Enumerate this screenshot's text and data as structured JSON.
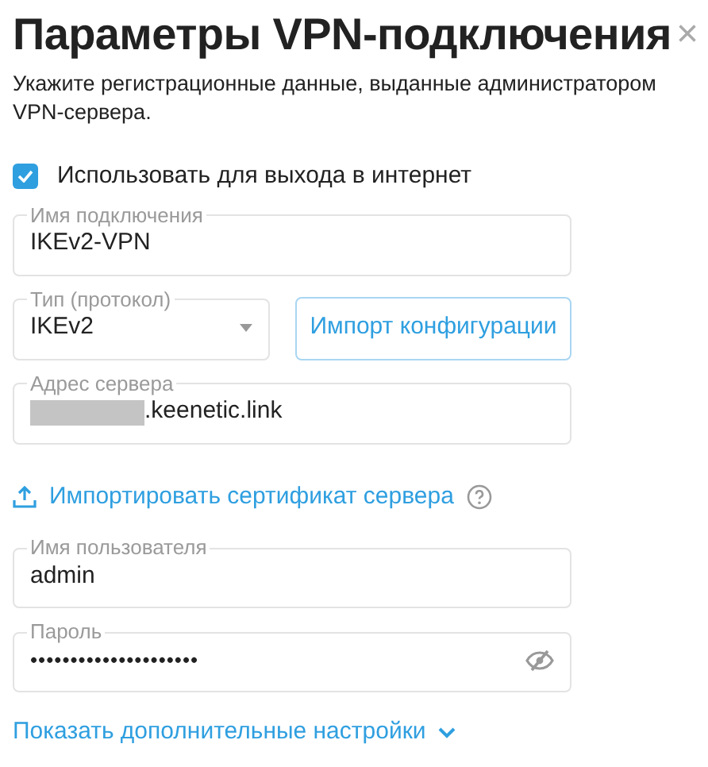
{
  "dialog": {
    "title": "Параметры VPN-подключения",
    "close": "×",
    "description": "Укажите регистрационные данные, выданные администратором VPN-сервера."
  },
  "internet_checkbox": {
    "label": "Использовать для выхода в интернет",
    "checked": true
  },
  "connection_name": {
    "label": "Имя подключения",
    "value": "IKEv2-VPN"
  },
  "protocol": {
    "label": "Тип (протокол)",
    "value": "IKEv2"
  },
  "import_config_button": "Импорт конфигурации",
  "server_address": {
    "label": "Адрес сервера",
    "value": ".keenetic.link",
    "redacted": true
  },
  "import_certificate_link": "Импортировать сертификат сервера",
  "username": {
    "label": "Имя пользователя",
    "value": "admin"
  },
  "password": {
    "label": "Пароль",
    "value": "•••••••••••••••••••••",
    "visible": false
  },
  "advanced_link": {
    "label": "Показать дополнительные настройки",
    "expanded": false
  }
}
